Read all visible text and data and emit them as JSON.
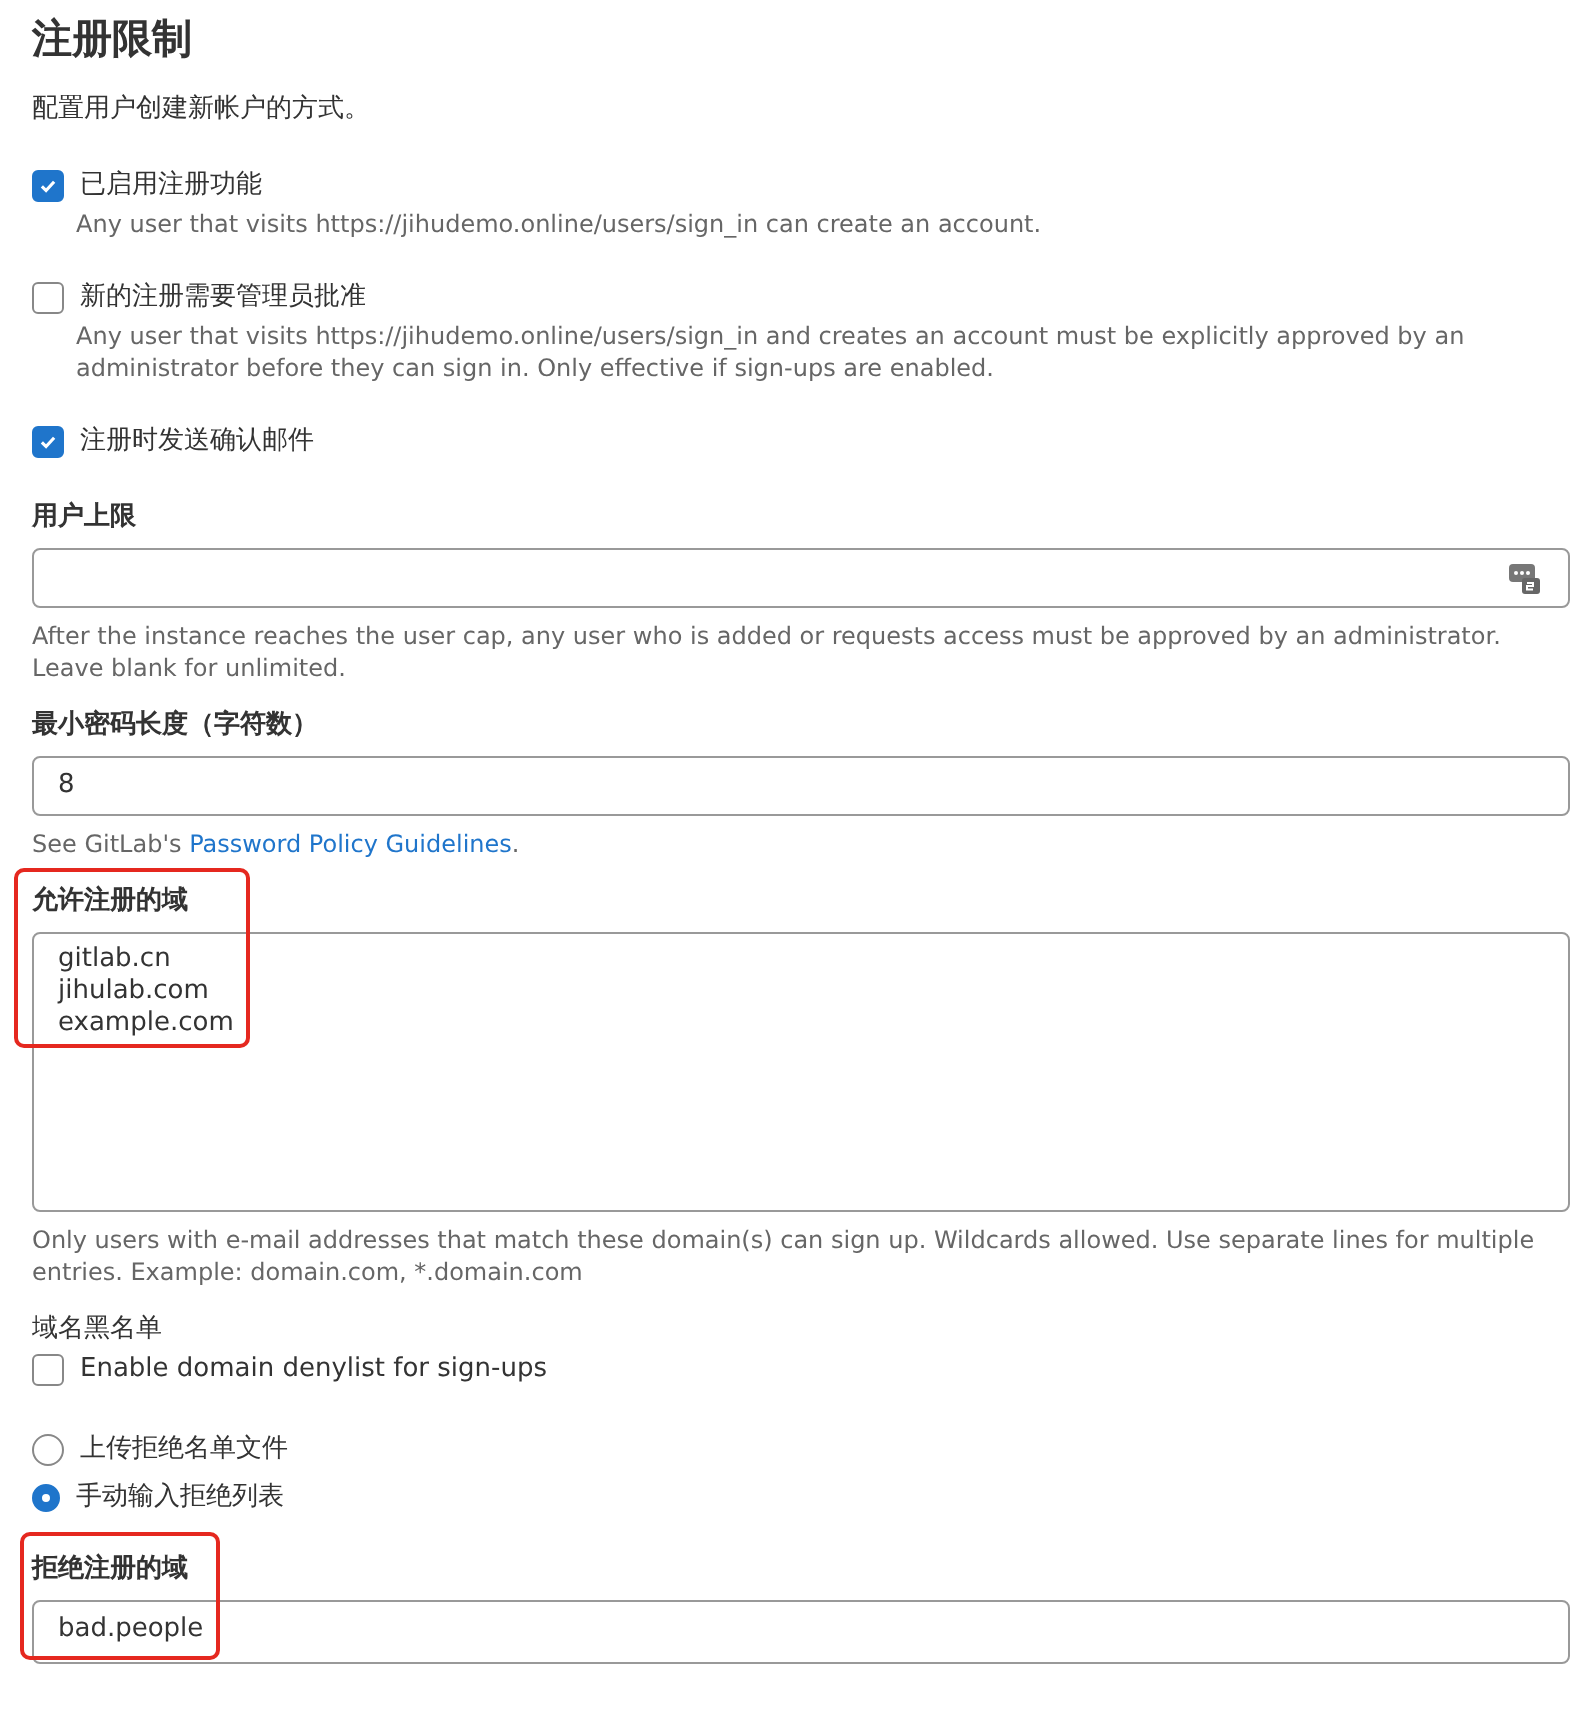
{
  "title": "注册限制",
  "description": "配置用户创建新帐户的方式。",
  "checkboxes": [
    {
      "label": "已启用注册功能",
      "checked": true,
      "help": "Any user that visits https://jihudemo.online/users/sign_in can create an account."
    },
    {
      "label": "新的注册需要管理员批准",
      "checked": false,
      "help": "Any user that visits https://jihudemo.online/users/sign_in and creates an account must be explicitly approved by an administrator before they can sign in. Only effective if sign-ups are enabled."
    },
    {
      "label": "注册时发送确认邮件",
      "checked": true
    }
  ],
  "user_cap": {
    "label": "用户上限",
    "help": "After the instance reaches the user cap, any user who is added or requests access must be approved by an administrator. Leave blank for unlimited."
  },
  "min_password": {
    "label": "最小密码长度（字符数）",
    "value": "8",
    "help_prefix": "See GitLab's ",
    "help_link": "Password Policy Guidelines",
    "help_suffix": "."
  },
  "allowed_domains": {
    "label": "允许注册的域",
    "value": "gitlab.cn\njihulab.com\nexample.com",
    "annotated": true,
    "help": "Only users with e-mail addresses that match these domain(s) can sign up. Wildcards allowed. Use separate lines for multiple entries. Example: domain.com, *.domain.com"
  },
  "denylist": {
    "label": "域名黑名单",
    "checkbox": {
      "label": "Enable domain denylist for sign-ups",
      "checked": false
    },
    "radios": [
      {
        "label": "上传拒绝名单文件",
        "selected": false
      },
      {
        "label": "手动输入拒绝列表",
        "selected": true
      }
    ],
    "field": {
      "label": "拒绝注册的域",
      "value": "bad.people",
      "annotated": true
    }
  }
}
